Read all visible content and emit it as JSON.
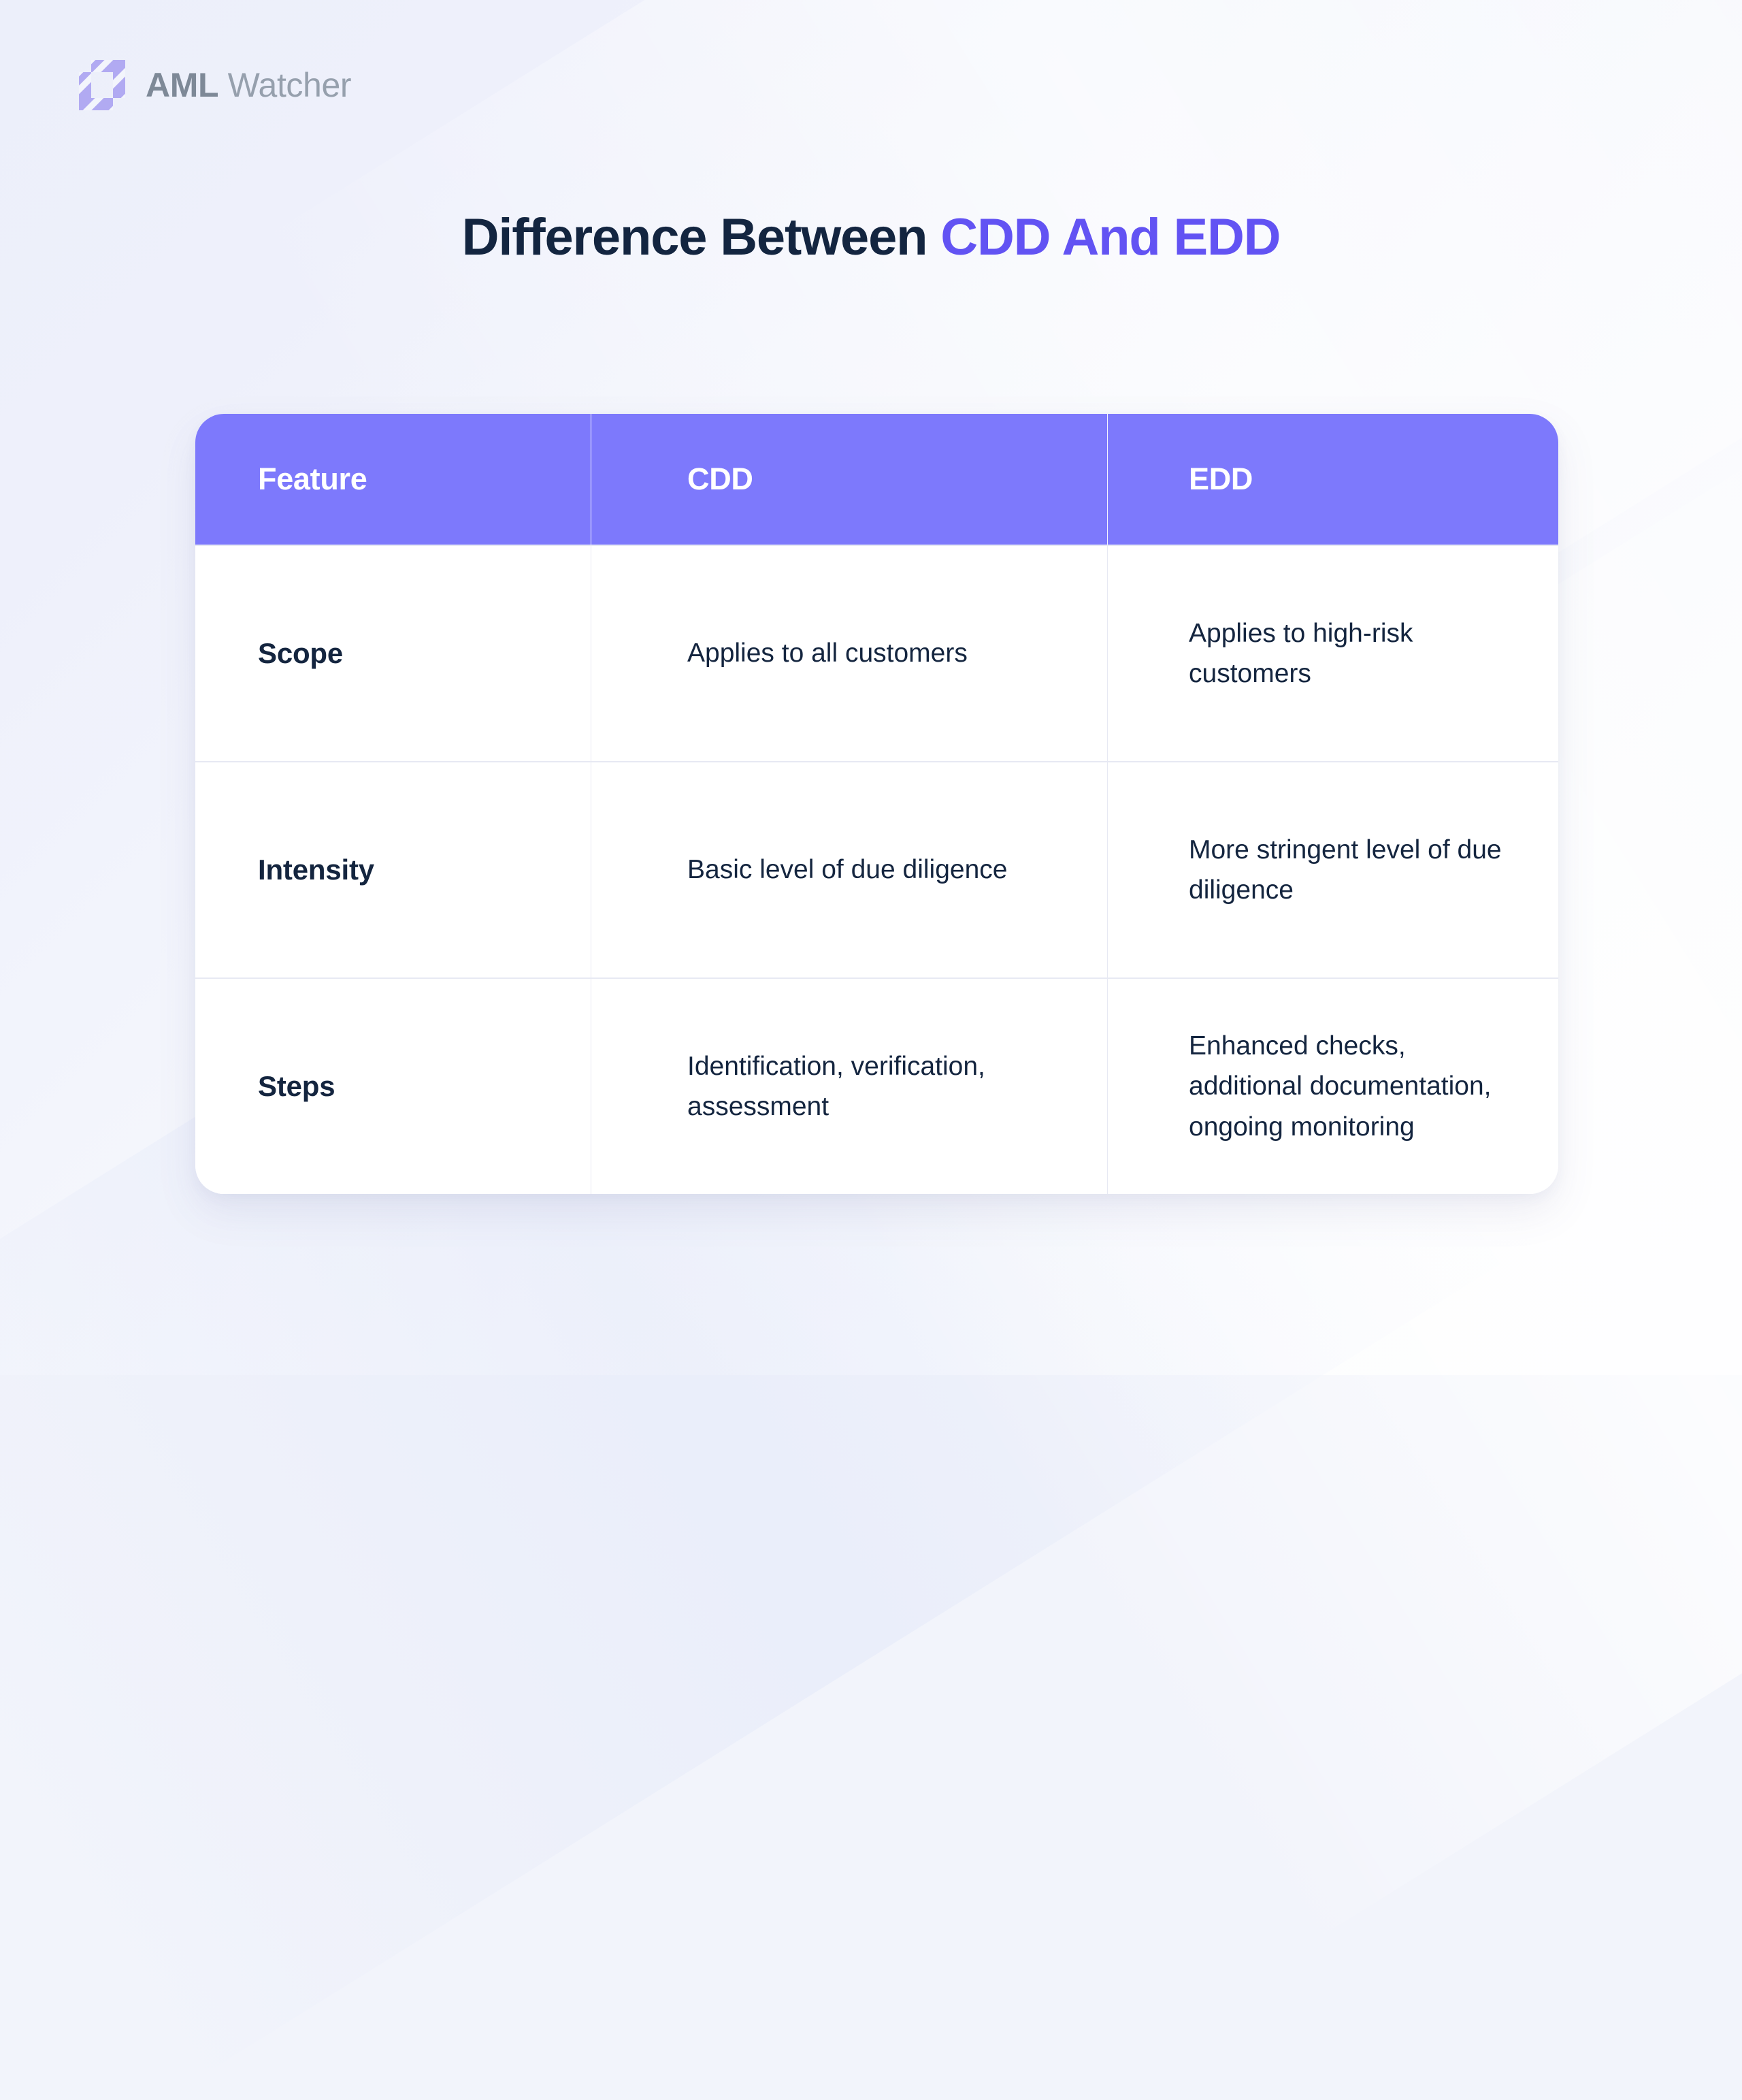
{
  "brand": {
    "mark_icon": "aml-watcher-stripes-logomark",
    "name_strong": "AML",
    "name_light": " Watcher"
  },
  "title": {
    "lead": "Difference Between ",
    "accent": "CDD And EDD"
  },
  "colors": {
    "header_purple": "#7d79fc",
    "title_accent": "#6253f3",
    "text_dark": "#14253f",
    "logo_purple": "#b1aaf2",
    "divider": "#e7e9f3",
    "card_bg": "#ffffff"
  },
  "table": {
    "headers": [
      "Feature",
      "CDD",
      "EDD"
    ],
    "rows": [
      {
        "feature": "Scope",
        "cdd": "Applies to all customers",
        "edd": "Applies to high-risk customers"
      },
      {
        "feature": "Intensity",
        "cdd": "Basic level of due diligence",
        "edd": "More stringent level of due diligence"
      },
      {
        "feature": "Steps",
        "cdd": "Identification, verification, assessment",
        "edd": "Enhanced checks, additional documentation, ongoing monitoring"
      }
    ]
  }
}
